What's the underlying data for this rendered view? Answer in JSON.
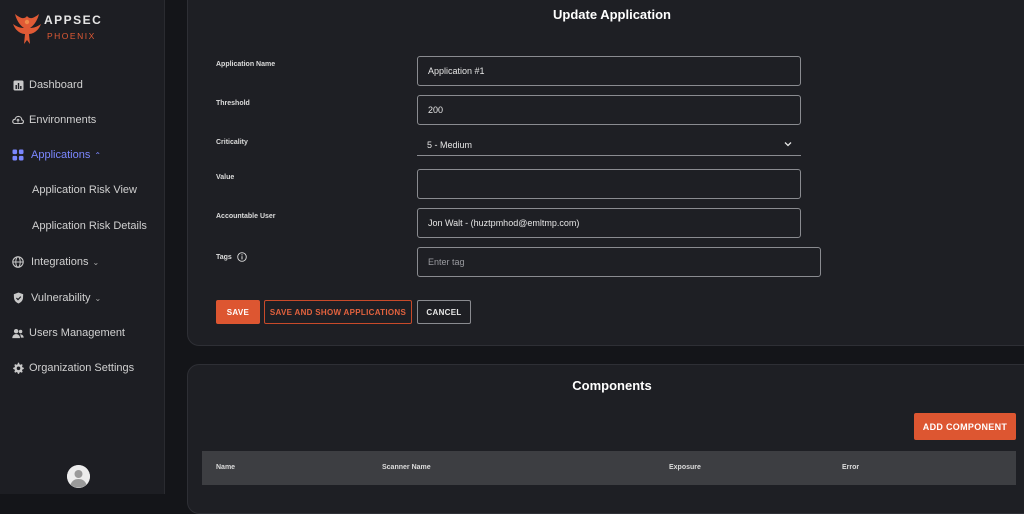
{
  "brand": {
    "line1": "APPSEC",
    "line2": "PHOENIX"
  },
  "sidebar": {
    "items": [
      {
        "label": "Dashboard",
        "icon": "chart-icon"
      },
      {
        "label": "Environments",
        "icon": "cloud-icon"
      },
      {
        "label": "Applications",
        "icon": "grid-icon",
        "active": true,
        "expanded": true
      },
      {
        "label": "Application Risk View",
        "sub": true
      },
      {
        "label": "Application Risk Details",
        "sub": true
      },
      {
        "label": "Integrations",
        "icon": "globe-icon"
      },
      {
        "label": "Vulnerability",
        "icon": "shield-icon"
      },
      {
        "label": "Users Management",
        "icon": "users-icon"
      },
      {
        "label": "Organization Settings",
        "icon": "gear-icon"
      }
    ]
  },
  "form": {
    "title": "Update Application",
    "fields": {
      "name": {
        "label": "Application Name",
        "value": "Application #1"
      },
      "threshold": {
        "label": "Threshold",
        "value": "200"
      },
      "criticality": {
        "label": "Criticality",
        "value": "5 - Medium"
      },
      "value": {
        "label": "Value",
        "value": ""
      },
      "user": {
        "label": "Accountable User",
        "value": "Jon Walt - (huztpmhod@emltmp.com)"
      },
      "tags": {
        "label": "Tags",
        "placeholder": "Enter tag"
      }
    },
    "buttons": {
      "save": "SAVE",
      "save_show": "SAVE AND SHOW APPLICATIONS",
      "cancel": "CANCEL"
    }
  },
  "components": {
    "title": "Components",
    "add_button": "ADD COMPONENT",
    "columns": [
      "Name",
      "Scanner Name",
      "Exposure",
      "Error"
    ]
  },
  "colors": {
    "accent": "#dd5631",
    "active_nav": "#7b87ff",
    "background": "#141519",
    "card": "#1e1f24"
  }
}
